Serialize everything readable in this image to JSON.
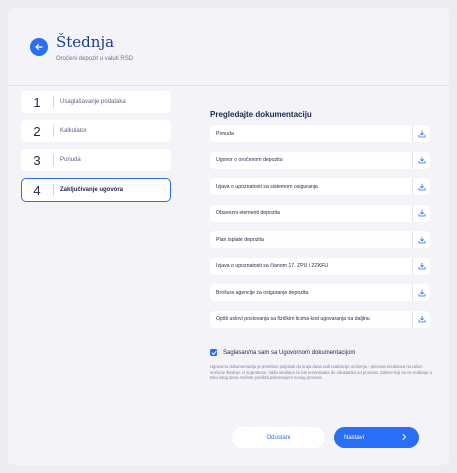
{
  "header": {
    "title": "Štednja",
    "subtitle": "Oročeni depozit u valuti RSD",
    "back_icon": "arrow-left-icon"
  },
  "steps": [
    {
      "num": "1",
      "label": "Usaglašavanje podataka",
      "active": false
    },
    {
      "num": "2",
      "label": "Kalkulator",
      "active": false
    },
    {
      "num": "3",
      "label": "Ponuda",
      "active": false
    },
    {
      "num": "4",
      "label": "Zaključivanje ugovora",
      "active": true
    }
  ],
  "documents": {
    "title": "Pregledajte dokumentaciju",
    "download_icon": "download-icon",
    "items": [
      "Ponuda",
      "Ugovor o oročenom depozitu",
      "Izjava o upoznatosti sa sistemom osiguranja",
      "Obavezni elementi depozita",
      "Plan isplate depozita",
      "Izjava o upoznatosti sa članom 17. ZPU i ZZKFU",
      "Brošura agencije za osiguranje depozita",
      "Opšti uslovi poslovanja sa fizičkim licima kod ugovaranja na  daljinu"
    ]
  },
  "agreement": {
    "checked": true,
    "label": "Saglasan/na sam sa Ugovornom dokumentacijom",
    "note": "Ugovornu dokumentaciju je potrebno potpisati do kraja dana radi realizacije oročenja - prenosa sredstava na račun oročene štednje. U suprotnom, Vaša sredstva će biti rezervisana do odustanka od procesa. Zahtev koji se ne realizuje u toku istog dana možete poništiti pokretanjem novog procesa."
  },
  "actions": {
    "cancel_label": "Odustani",
    "next_label": "Nastavi"
  },
  "colors": {
    "accent": "#2a6ef5",
    "text": "#1d2550",
    "background": "#f4f4f8"
  }
}
